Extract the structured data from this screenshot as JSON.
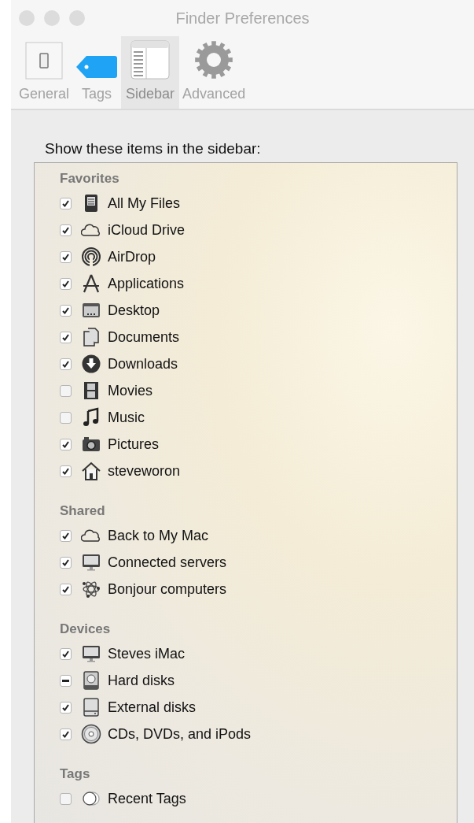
{
  "window": {
    "title": "Finder Preferences"
  },
  "tabs": [
    {
      "label": "General",
      "kind": "general",
      "selected": false
    },
    {
      "label": "Tags",
      "kind": "tags",
      "selected": false
    },
    {
      "label": "Sidebar",
      "kind": "sidebar",
      "selected": true
    },
    {
      "label": "Advanced",
      "kind": "advanced",
      "selected": false
    }
  ],
  "prompt": "Show these items in the sidebar:",
  "sections": [
    {
      "title": "Favorites",
      "items": [
        {
          "label": "All My Files",
          "kind": "files",
          "checked": true,
          "mixed": false
        },
        {
          "label": "iCloud Drive",
          "kind": "cloud",
          "checked": true,
          "mixed": false
        },
        {
          "label": "AirDrop",
          "kind": "airdrop",
          "checked": true,
          "mixed": false
        },
        {
          "label": "Applications",
          "kind": "apps",
          "checked": true,
          "mixed": false
        },
        {
          "label": "Desktop",
          "kind": "desktop",
          "checked": true,
          "mixed": false
        },
        {
          "label": "Documents",
          "kind": "documents",
          "checked": true,
          "mixed": false
        },
        {
          "label": "Downloads",
          "kind": "downloads",
          "checked": true,
          "mixed": false
        },
        {
          "label": "Movies",
          "kind": "movies",
          "checked": false,
          "mixed": false
        },
        {
          "label": "Music",
          "kind": "music",
          "checked": false,
          "mixed": false
        },
        {
          "label": "Pictures",
          "kind": "pictures",
          "checked": true,
          "mixed": false
        },
        {
          "label": "steveworon",
          "kind": "home",
          "checked": true,
          "mixed": false
        }
      ]
    },
    {
      "title": "Shared",
      "items": [
        {
          "label": "Back to My Mac",
          "kind": "cloud",
          "checked": true,
          "mixed": false
        },
        {
          "label": "Connected servers",
          "kind": "monitor",
          "checked": true,
          "mixed": false
        },
        {
          "label": "Bonjour computers",
          "kind": "bonjour",
          "checked": true,
          "mixed": false
        }
      ]
    },
    {
      "title": "Devices",
      "items": [
        {
          "label": "Steves iMac",
          "kind": "monitor",
          "checked": true,
          "mixed": false
        },
        {
          "label": "Hard disks",
          "kind": "harddisk",
          "checked": true,
          "mixed": true
        },
        {
          "label": "External disks",
          "kind": "external",
          "checked": true,
          "mixed": false
        },
        {
          "label": "CDs, DVDs, and iPods",
          "kind": "disc",
          "checked": true,
          "mixed": false
        }
      ]
    },
    {
      "title": "Tags",
      "items": [
        {
          "label": "Recent Tags",
          "kind": "tagcircles",
          "checked": false,
          "mixed": false
        }
      ]
    }
  ]
}
